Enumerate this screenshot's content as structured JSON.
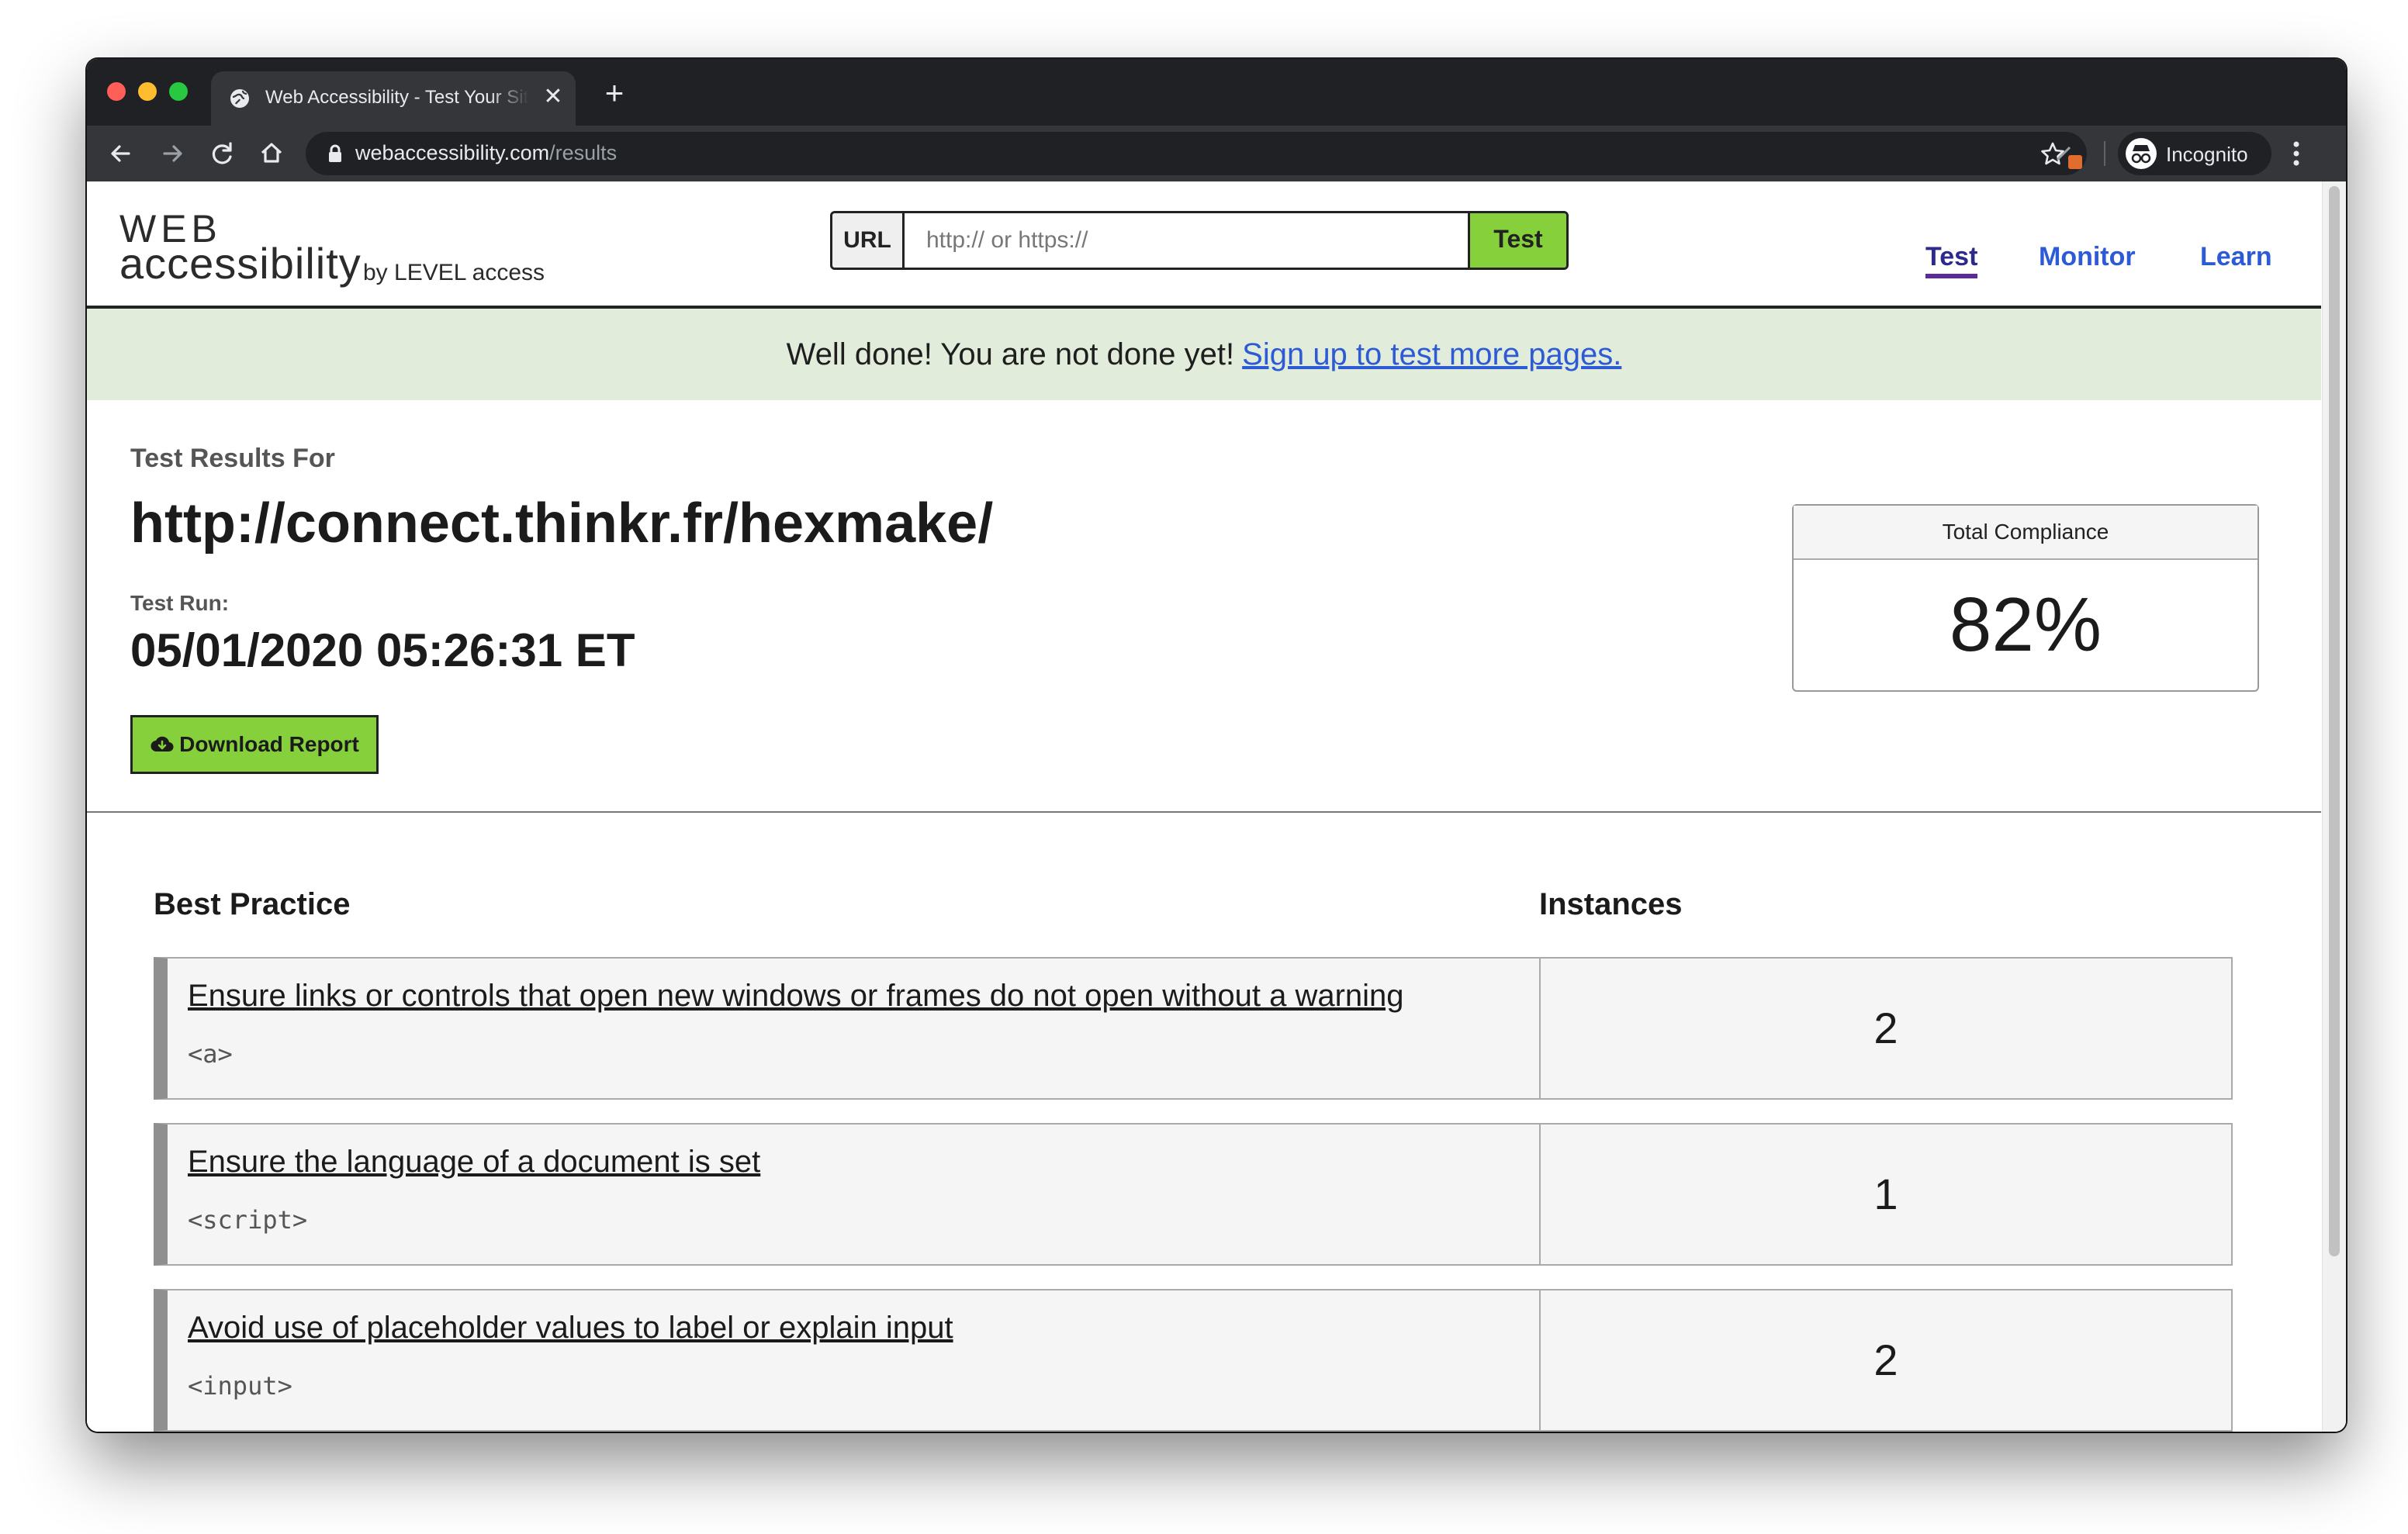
{
  "browser": {
    "tab_title": "Web Accessibility - Test Your Site",
    "new_tab": "+",
    "close": "✕",
    "url_host": "webaccessibility.com",
    "url_path": "/results",
    "incognito_label": "Incognito"
  },
  "header": {
    "logo_web": "WEB",
    "logo_accessibility": "accessibility",
    "logo_by": "by LEVEL access",
    "url_label": "URL",
    "url_placeholder": "http:// or https://",
    "url_value": "",
    "test_button": "Test",
    "nav": [
      "Test",
      "Monitor",
      "Learn"
    ]
  },
  "banner": {
    "message": "Well done! You are not done yet!",
    "link": "Sign up to test more pages."
  },
  "results": {
    "for_label": "Test Results For",
    "url": "http://connect.thinkr.fr/hexmake/",
    "run_label": "Test Run:",
    "run_date": "05/01/2020 05:26:31 ET",
    "download_label": "Download Report",
    "compliance_label": "Total Compliance",
    "compliance_value": "82%"
  },
  "table": {
    "col_best_practice": "Best Practice",
    "col_instances": "Instances",
    "rows": [
      {
        "title": "Ensure links or controls that open new windows or frames do not open without a warning",
        "tag": "<a>",
        "count": "2"
      },
      {
        "title": "Ensure the language of a document is set",
        "tag": "<script>",
        "count": "1"
      },
      {
        "title": "Avoid use of placeholder values to label or explain input",
        "tag": "<input>",
        "count": "2"
      }
    ]
  },
  "colors": {
    "accent_green": "#86d13b",
    "link_blue": "#2d5bd6",
    "banner_bg": "#e2ecdb"
  }
}
